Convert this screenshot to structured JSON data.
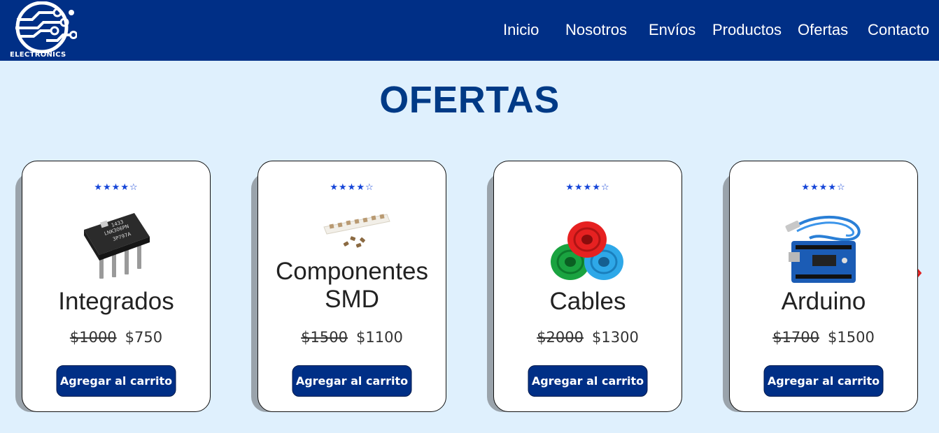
{
  "brand": {
    "logo_text": "ELECTRONICS"
  },
  "nav": {
    "items": [
      {
        "label": "Inicio"
      },
      {
        "label": "Nosotros"
      },
      {
        "label": "Envíos"
      },
      {
        "label": "Productos"
      },
      {
        "label": "Ofertas"
      },
      {
        "label": "Contacto"
      }
    ]
  },
  "page": {
    "title": "OFERTAS"
  },
  "carousel": {
    "prev_icon": "chevron-left-icon",
    "next_icon": "chevron-right-icon",
    "arrow_color": "#e02020"
  },
  "products": [
    {
      "name": "Integrados",
      "rating": 4,
      "rating_max": 5,
      "old_price": "$1000",
      "price": "$750",
      "button": "Agregar al carrito",
      "image": "ic-chip-image"
    },
    {
      "name": "Componentes SMD",
      "rating": 4,
      "rating_max": 5,
      "old_price": "$1500",
      "price": "$1100",
      "button": "Agregar al carrito",
      "image": "smd-components-image"
    },
    {
      "name": "Cables",
      "rating": 4,
      "rating_max": 5,
      "old_price": "$2000",
      "price": "$1300",
      "button": "Agregar al carrito",
      "image": "cable-spools-image"
    },
    {
      "name": "Arduino",
      "rating": 4,
      "rating_max": 5,
      "old_price": "$1700",
      "price": "$1500",
      "button": "Agregar al carrito",
      "image": "arduino-board-image"
    }
  ],
  "colors": {
    "nav_bg": "#002f86",
    "page_bg": "#dff0fd",
    "title": "#003a86",
    "star": "#1545d8",
    "button_bg": "#002f86"
  }
}
